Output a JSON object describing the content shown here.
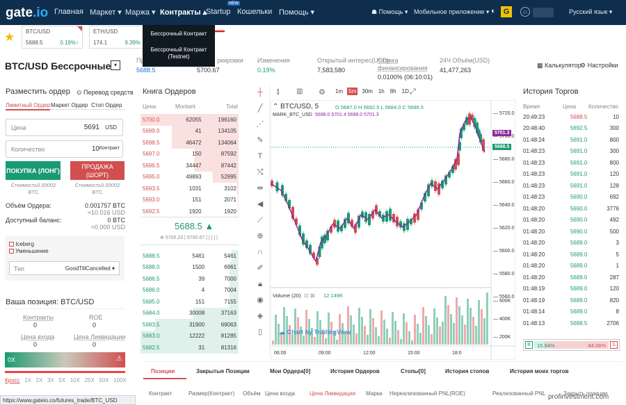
{
  "nav": {
    "logo_a": "gate",
    "logo_b": ".io",
    "items": [
      "Главная",
      "Маркет ▾",
      "Маржа ▾",
      "Контракты ▴",
      "Startup",
      "Кошельки",
      "Помощь ▾"
    ],
    "new_badge": "NEW",
    "right": [
      "☗ Помощь ▾",
      "Мобильное приложение ▾",
      "Русский язык ▾"
    ]
  },
  "tickers": [
    {
      "name": "BTC/USD",
      "price": "5688.5",
      "change": "0.19%↑"
    },
    {
      "name": "ETH/USD",
      "price": "174.1",
      "change": "9.39%"
    }
  ],
  "dropdown": {
    "items": [
      "Бессрочный Контракт",
      "Бессрочный Контракт (Testnet)"
    ]
  },
  "header": {
    "title": "BTC/USD Бессрочные",
    "stats": [
      {
        "label": "Пр",
        "value": "5688.5"
      },
      {
        "label": "ркировки",
        "value": "5700.67"
      },
      {
        "label": "Изменения",
        "value": "0.19%"
      },
      {
        "label": "Открытый интерес(USD)",
        "value": "7,583,580"
      },
      {
        "label": "Ставка финансирования",
        "value": "0.0100% (06:10:01)"
      },
      {
        "label": "24Ч Объём(USD)",
        "value": "41,477,263"
      }
    ],
    "calc": "Калькулятор",
    "settings": "Настройки"
  },
  "order": {
    "title": "Разместить ордер",
    "transfer": "Перевод средств",
    "tabs": [
      "Лимитный Ордер",
      "Маркет Ордер",
      "Стоп Ордер"
    ],
    "price_label": "Цена",
    "price_value": "5691",
    "price_unit": "USD",
    "qty_label": "Количество",
    "qty_value": "10",
    "qty_unit": "Контракт",
    "buy": "ПОКУПКА (ЛОНГ)",
    "sell": "ПРОДАЖА (ШОРТ)",
    "cost_buy": "Стоимость0.00002 BTC",
    "cost_sell": "Стоимость0.00002 BTC",
    "volume_label": "Объём Ордера:",
    "volume_value": "0.001757 BTC",
    "volume_sub": "≈10.016 USD",
    "avail_label": "Доступный баланс:",
    "avail_value": "0 BTC",
    "avail_sub": "≈0.000 USD",
    "iceberg": "Iceberg",
    "reduce": "Уменьшение",
    "type_label": "Тип",
    "type_value": "GoodTillCancelled ▾"
  },
  "position": {
    "title": "Ваша позиция: BTC/USD",
    "contracts_label": "Контракты",
    "contracts_value": "0",
    "roe_label": "ROE",
    "roe_value": "0",
    "entry_label": "Цена входа",
    "entry_value": "0",
    "liq_label": "Цена Ликвидации",
    "liq_value": "0",
    "lev_value": "0X",
    "levs": [
      "Кросс",
      "1X",
      "2X",
      "3X",
      "5X",
      "10X",
      "25X",
      "50X",
      "100X"
    ]
  },
  "orderbook": {
    "title": "Книга Ордеров",
    "cols": [
      "Цена",
      "Montant",
      "Total"
    ],
    "asks": [
      [
        "5700.0",
        "62055",
        "196160"
      ],
      [
        "5699.0",
        "41",
        "134105"
      ],
      [
        "5698.5",
        "46472",
        "134064"
      ],
      [
        "5697.0",
        "150",
        "87592"
      ],
      [
        "5696.5",
        "34447",
        "87442"
      ],
      [
        "5695.0",
        "49893",
        "52995"
      ],
      [
        "5693.5",
        "1031",
        "3102"
      ],
      [
        "5693.0",
        "151",
        "2071"
      ],
      [
        "5692.5",
        "1920",
        "1920"
      ]
    ],
    "last": "5688.5 ▲",
    "sub": "⊕ 5700.23 | 5700.67 | | | | |",
    "bids": [
      [
        "5688.5",
        "5461",
        "5461"
      ],
      [
        "5688.0",
        "1500",
        "6961"
      ],
      [
        "5686.5",
        "39",
        "7000"
      ],
      [
        "5686.0",
        "4",
        "7004"
      ],
      [
        "5685.0",
        "151",
        "7155"
      ],
      [
        "5684.0",
        "30008",
        "37163"
      ],
      [
        "5683.5",
        "31900",
        "69063"
      ],
      [
        "5683.0",
        "12222",
        "81285"
      ],
      [
        "5682.5",
        "31",
        "81316"
      ]
    ]
  },
  "chart": {
    "intervals": [
      "1m",
      "5m",
      "30m",
      "1h",
      "8h",
      "1D"
    ],
    "active_interval": "5m",
    "symbol": "BTC/USD, 5",
    "ohlc": "O 5687.0  H 5692.5  L 5684.0  C 5688.5",
    "mark_label": "MARK_BTC_USD",
    "mark_vals": "5698.0  5701.4  5698.0  5701.3",
    "tag_mark": "5701.3",
    "tag_price": "5688.5",
    "volume_label": "Volume (20)",
    "volume_value": "12.149K",
    "watermark": "Chart by TradingView",
    "y_ticks": [
      "5720.0",
      "5700.0",
      "5680.0",
      "5660.0",
      "5640.0",
      "5620.0",
      "5600.0",
      "5580.0",
      "5560.0",
      "600K",
      "400K",
      "200K"
    ],
    "x_ticks": [
      "06:00",
      "09:00",
      "12:00",
      "15:00",
      "18:0"
    ]
  },
  "trades": {
    "title": "История Торгов",
    "cols": [
      "Время",
      "Цена",
      "Количество"
    ],
    "rows": [
      [
        "20:49:23",
        "5688.5",
        "10",
        "r"
      ],
      [
        "20:48:40",
        "5692.5",
        "300",
        "g"
      ],
      [
        "01:48:24",
        "5691.0",
        "800",
        "g"
      ],
      [
        "01:48:23",
        "5691.0",
        "300",
        "g"
      ],
      [
        "01:48:23",
        "5691.0",
        "800",
        "g"
      ],
      [
        "01:48:23",
        "5691.0",
        "120",
        "g"
      ],
      [
        "01:48:23",
        "5691.0",
        "128",
        "g"
      ],
      [
        "01:48:23",
        "5690.0",
        "692",
        "g"
      ],
      [
        "01:48:20",
        "5690.0",
        "3776",
        "g"
      ],
      [
        "01:48:20",
        "5690.0",
        "492",
        "g"
      ],
      [
        "01:48:20",
        "5690.0",
        "500",
        "g"
      ],
      [
        "01:48:20",
        "5689.0",
        "3",
        "g"
      ],
      [
        "01:48:20",
        "5689.0",
        "5",
        "g"
      ],
      [
        "01:48:20",
        "5689.0",
        "1",
        "g"
      ],
      [
        "01:48:20",
        "5689.0",
        "287",
        "g"
      ],
      [
        "01:48:19",
        "5689.0",
        "120",
        "g"
      ],
      [
        "01:48:19",
        "5689.0",
        "820",
        "g"
      ],
      [
        "01:48:14",
        "5689.0",
        "8",
        "g"
      ],
      [
        "01:48:13",
        "5688.5",
        "2706",
        "g"
      ]
    ],
    "buy_pct": "15.94%",
    "sell_pct": "84.06%",
    "b": "B",
    "s": "S"
  },
  "bottom": {
    "tabs": [
      "Позиции",
      "Закрытые Позиции",
      "Мои Ордера[0]",
      "История Ордеров",
      "Стопы[0]",
      "История стопов",
      "История моих торгов"
    ],
    "headers": [
      "Контракт",
      "Размер(Контракт)",
      "Объём",
      "Цена входа",
      "Цена Ликвидации",
      "Маркa",
      "Нереализованный PNL(ROE)",
      "Реализованный PNL",
      "Закрыть позиции"
    ]
  },
  "status": {
    "url": "https://www.gateio.co/futures_trade/BTC_USD",
    "watermark": "profinvestment.com"
  },
  "colors": {
    "nav": "#0f2e4d",
    "buy": "#1a9a72",
    "sell": "#d14f4f"
  }
}
